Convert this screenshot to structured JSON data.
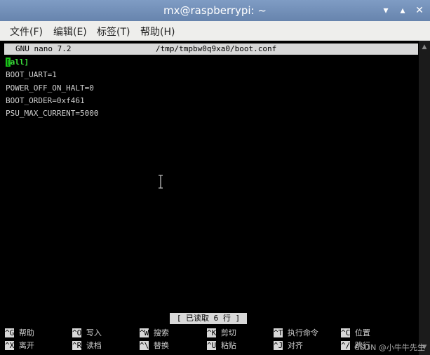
{
  "window": {
    "title": "mx@raspberrypi: ~"
  },
  "menu": [
    "文件(F)",
    "编辑(E)",
    "标签(T)",
    "帮助(H)"
  ],
  "nano": {
    "version": "GNU nano 7.2",
    "path": "/tmp/tmpbw0q9xa0/boot.conf"
  },
  "file": {
    "section_cursor": "[",
    "section_rest": "all]",
    "lines": [
      "BOOT_UART=1",
      "POWER_OFF_ON_HALT=0",
      "BOOT_ORDER=0xf461",
      "PSU_MAX_CURRENT=5000"
    ]
  },
  "status": "[ 已读取 6 行 ]",
  "shortcuts": [
    {
      "key": "^G",
      "label": "帮助"
    },
    {
      "key": "^O",
      "label": "写入"
    },
    {
      "key": "^W",
      "label": "搜索"
    },
    {
      "key": "^K",
      "label": "剪切"
    },
    {
      "key": "^T",
      "label": "执行命令"
    },
    {
      "key": "^C",
      "label": "位置"
    },
    {
      "key": "^X",
      "label": "离开"
    },
    {
      "key": "^R",
      "label": "读档"
    },
    {
      "key": "^\\",
      "label": "替换"
    },
    {
      "key": "^U",
      "label": "粘贴"
    },
    {
      "key": "^J",
      "label": "对齐"
    },
    {
      "key": "^/",
      "label": "跳行"
    }
  ],
  "watermark": "CSDN @小牛牛先生"
}
